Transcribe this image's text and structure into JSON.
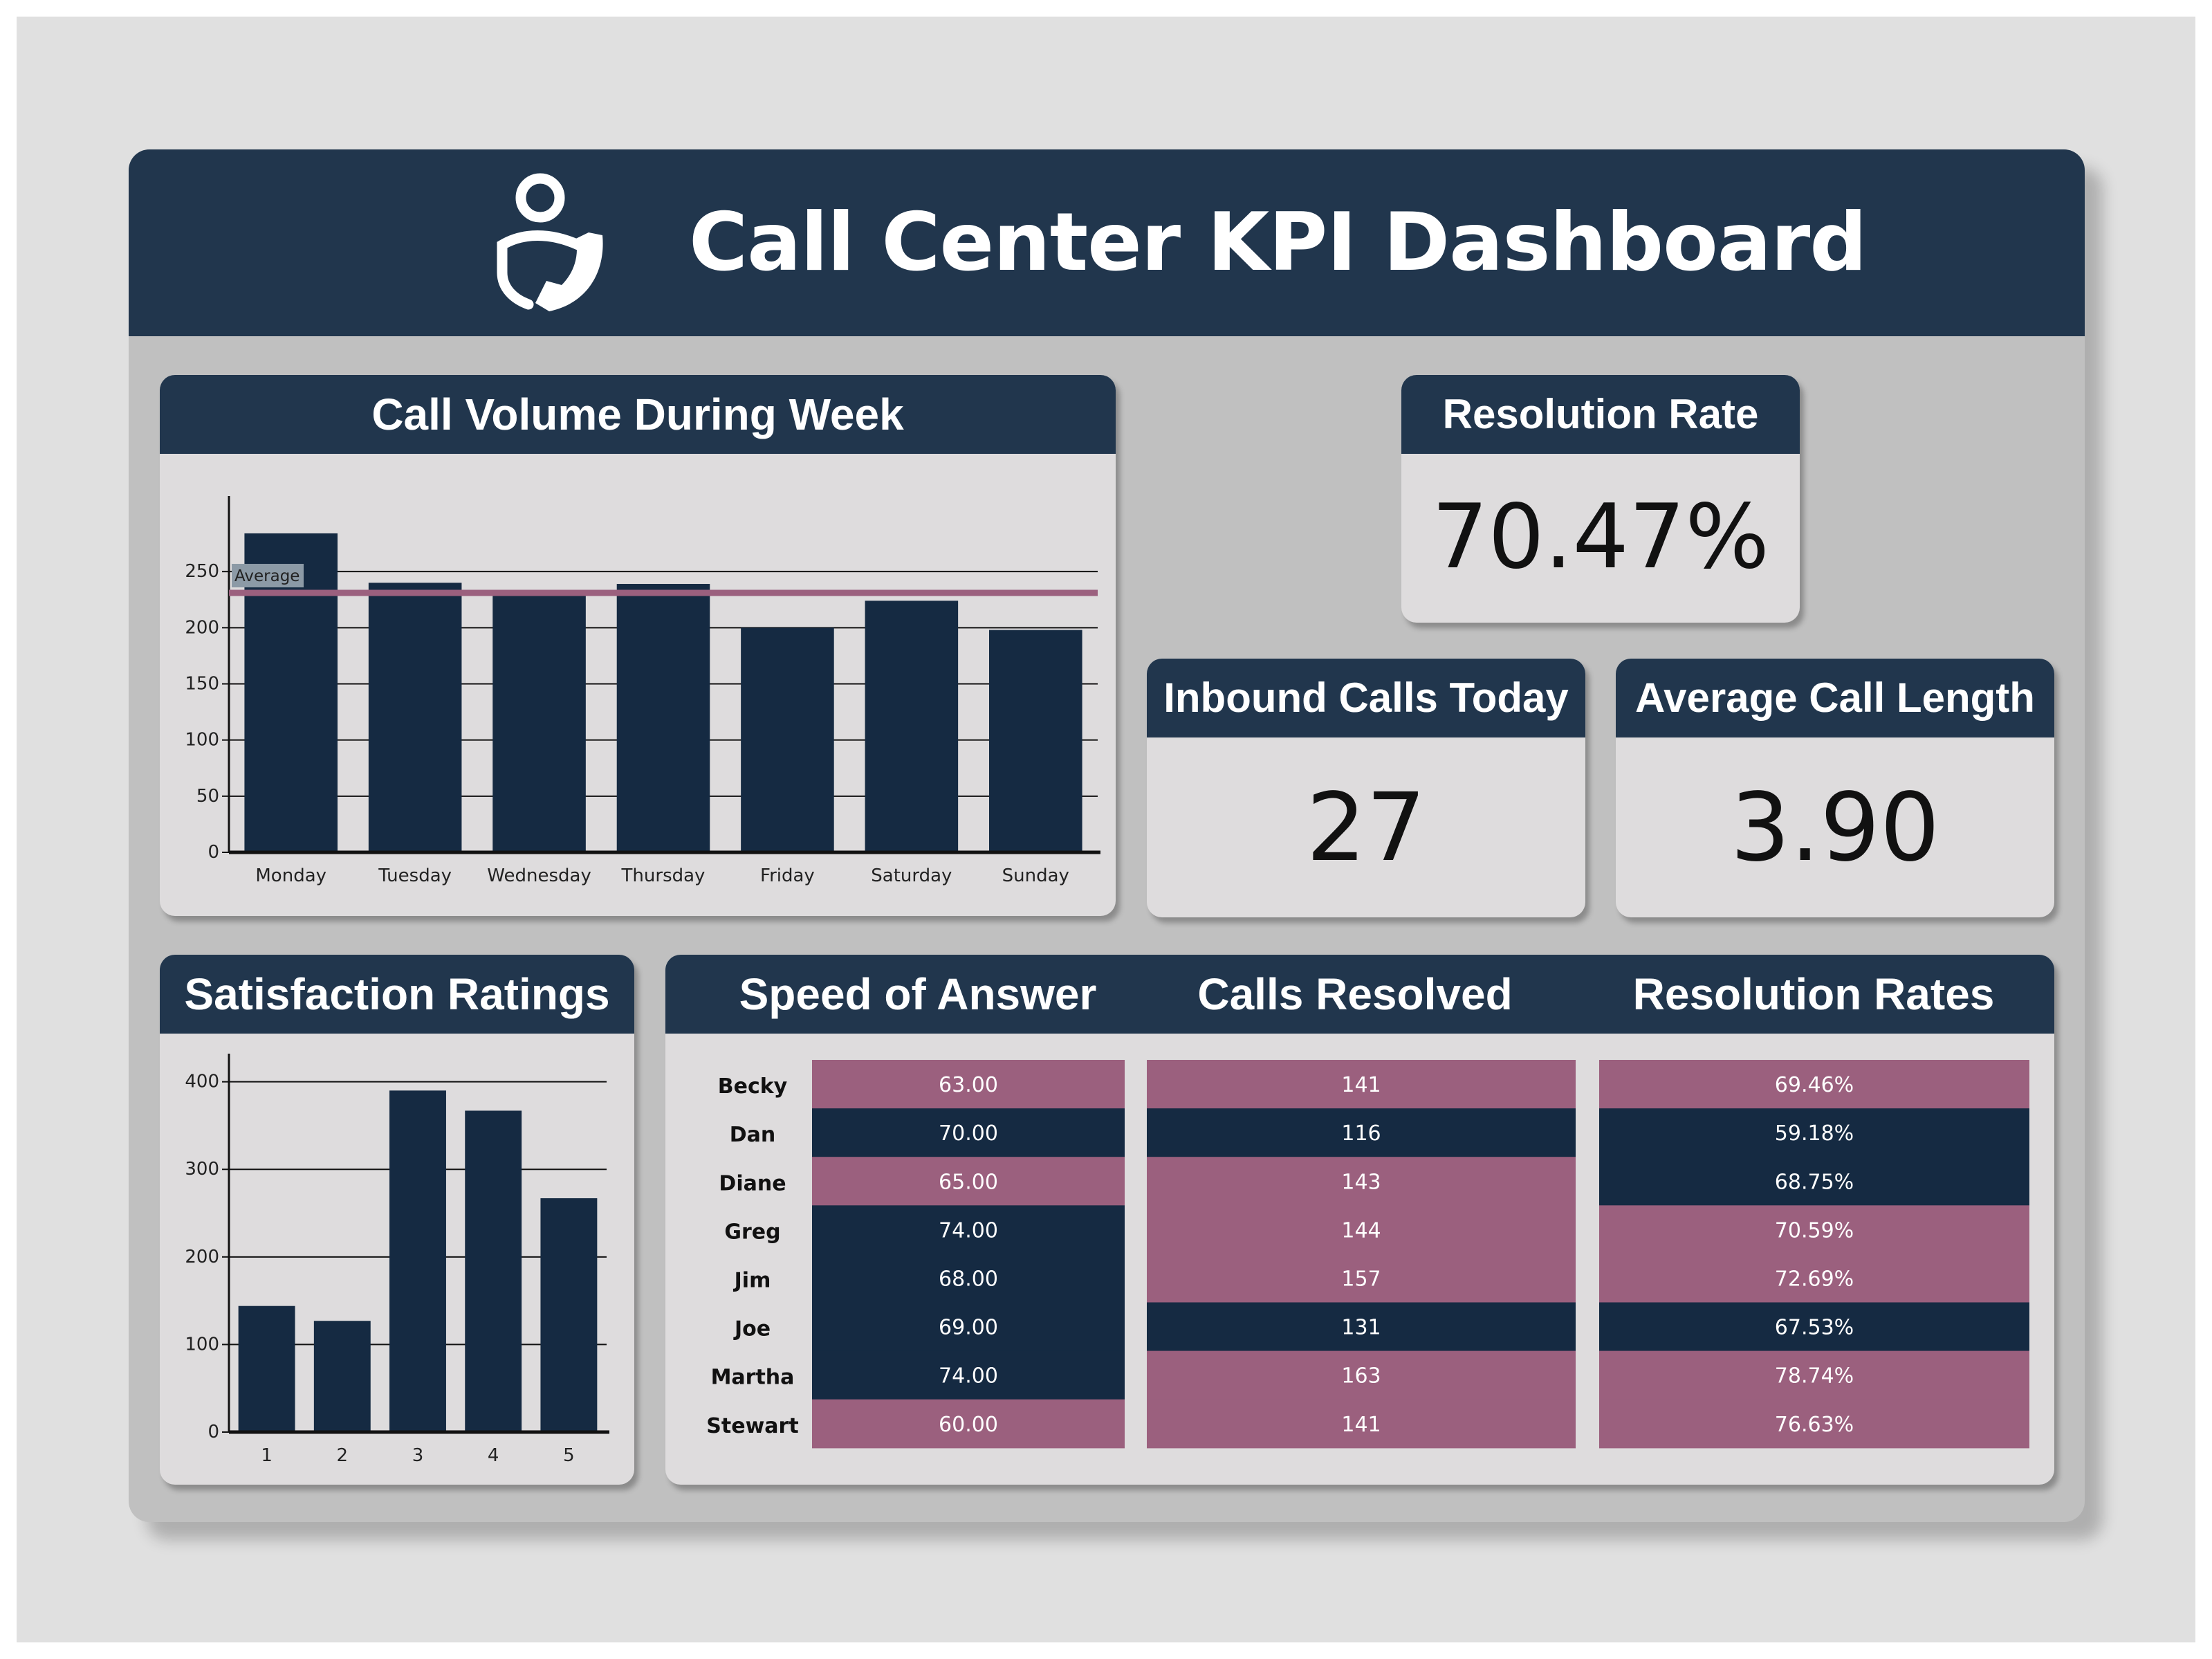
{
  "dashboard": {
    "title": "Call Center KPI Dashboard",
    "logo_icon": "person-phone-icon",
    "colors": {
      "navy": "#152a42",
      "header": "#21364d",
      "mauve": "#9b607e",
      "card": "#dedcdd"
    }
  },
  "kpis": {
    "resolution_rate": {
      "title": "Resolution Rate",
      "value": "70.47%"
    },
    "inbound_calls": {
      "title": "Inbound Calls Today",
      "value": "27"
    },
    "avg_call_length": {
      "title": "Average Call Length",
      "value": "3.90"
    }
  },
  "call_volume": {
    "title": "Call Volume During Week"
  },
  "satisfaction": {
    "title": "Satisfaction Ratings"
  },
  "table": {
    "headers": {
      "speed": "Speed of Answer",
      "resolved": "Calls Resolved",
      "rates": "Resolution Rates"
    },
    "rows": [
      {
        "name": "Becky",
        "speed": "63.00",
        "resolved": "141",
        "rate": "69.46%",
        "speed_hi": true,
        "resolved_hi": true,
        "rate_hi": true
      },
      {
        "name": "Dan",
        "speed": "70.00",
        "resolved": "116",
        "rate": "59.18%",
        "speed_hi": false,
        "resolved_hi": false,
        "rate_hi": false
      },
      {
        "name": "Diane",
        "speed": "65.00",
        "resolved": "143",
        "rate": "68.75%",
        "speed_hi": true,
        "resolved_hi": true,
        "rate_hi": false
      },
      {
        "name": "Greg",
        "speed": "74.00",
        "resolved": "144",
        "rate": "70.59%",
        "speed_hi": false,
        "resolved_hi": true,
        "rate_hi": true
      },
      {
        "name": "Jim",
        "speed": "68.00",
        "resolved": "157",
        "rate": "72.69%",
        "speed_hi": false,
        "resolved_hi": true,
        "rate_hi": true
      },
      {
        "name": "Joe",
        "speed": "69.00",
        "resolved": "131",
        "rate": "67.53%",
        "speed_hi": false,
        "resolved_hi": false,
        "rate_hi": false
      },
      {
        "name": "Martha",
        "speed": "74.00",
        "resolved": "163",
        "rate": "78.74%",
        "speed_hi": false,
        "resolved_hi": true,
        "rate_hi": true
      },
      {
        "name": "Stewart",
        "speed": "60.00",
        "resolved": "141",
        "rate": "76.63%",
        "speed_hi": true,
        "resolved_hi": true,
        "rate_hi": true
      }
    ]
  },
  "chart_data": [
    {
      "type": "bar",
      "title": "Call Volume During Week",
      "categories": [
        "Monday",
        "Tuesday",
        "Wednesday",
        "Thursday",
        "Friday",
        "Saturday",
        "Sunday"
      ],
      "values": [
        284,
        240,
        229,
        239,
        200,
        224,
        198
      ],
      "ylim": [
        0,
        300
      ],
      "yticks": [
        0,
        50,
        100,
        150,
        200,
        250
      ],
      "reference_line": {
        "label": "Average",
        "value": 231
      },
      "grid": true,
      "color": "#152a42",
      "line_color": "#9b607e"
    },
    {
      "type": "bar",
      "title": "Satisfaction Ratings",
      "categories": [
        "1",
        "2",
        "3",
        "4",
        "5"
      ],
      "values": [
        144,
        127,
        390,
        367,
        267
      ],
      "ylim": [
        0,
        410
      ],
      "yticks": [
        0,
        100,
        200,
        300,
        400
      ],
      "grid": true,
      "color": "#152a42"
    }
  ]
}
